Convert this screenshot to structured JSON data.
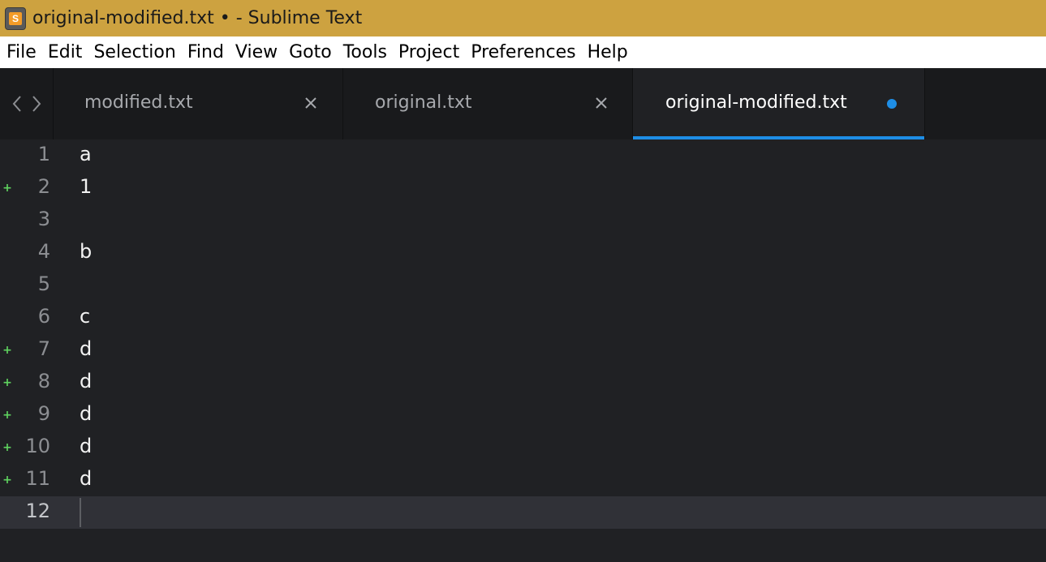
{
  "window": {
    "title": "original-modified.txt • - Sublime Text",
    "app_icon": "sublime-text-icon",
    "app_icon_letter": "S"
  },
  "menu": [
    "File",
    "Edit",
    "Selection",
    "Find",
    "View",
    "Goto",
    "Tools",
    "Project",
    "Preferences",
    "Help"
  ],
  "tabs": [
    {
      "label": "modified.txt",
      "active": false,
      "dirty": false
    },
    {
      "label": "original.txt",
      "active": false,
      "dirty": false
    },
    {
      "label": "original-modified.txt",
      "active": true,
      "dirty": true
    }
  ],
  "editor": {
    "current_line": 12,
    "lines": [
      {
        "number": "1",
        "text": "a",
        "added": false
      },
      {
        "number": "2",
        "text": "1",
        "added": true
      },
      {
        "number": "3",
        "text": "",
        "added": false
      },
      {
        "number": "4",
        "text": "b",
        "added": false
      },
      {
        "number": "5",
        "text": "",
        "added": false
      },
      {
        "number": "6",
        "text": "c",
        "added": false
      },
      {
        "number": "7",
        "text": "d",
        "added": true
      },
      {
        "number": "8",
        "text": "d",
        "added": true
      },
      {
        "number": "9",
        "text": "d",
        "added": true
      },
      {
        "number": "10",
        "text": "d",
        "added": true
      },
      {
        "number": "11",
        "text": "d",
        "added": true
      },
      {
        "number": "12",
        "text": "",
        "added": false
      }
    ]
  },
  "colors": {
    "titlebar": "#cda240",
    "accent": "#1e8ee6",
    "diff_added": "#5fd35f",
    "editor_bg": "#202124"
  }
}
